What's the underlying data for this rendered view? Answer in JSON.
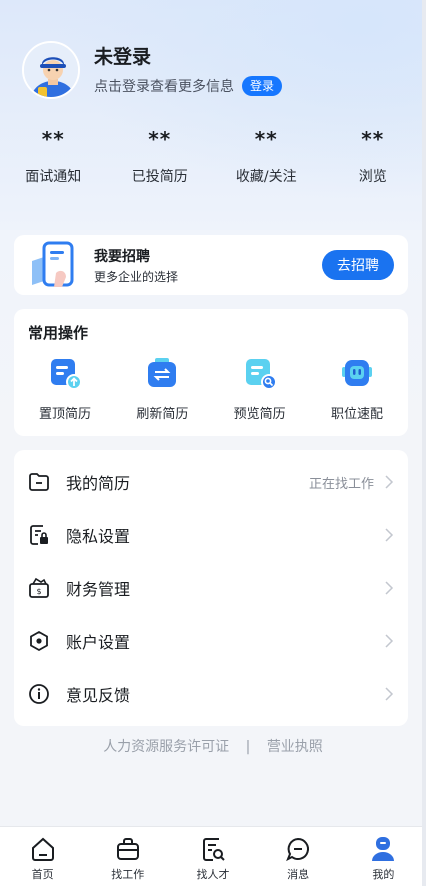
{
  "profile": {
    "name": "未登录",
    "hint": "点击登录查看更多信息",
    "login_label": "登录"
  },
  "stats": [
    {
      "value": "**",
      "label": "面试通知"
    },
    {
      "value": "**",
      "label": "已投简历"
    },
    {
      "value": "**",
      "label": "收藏/关注"
    },
    {
      "value": "**",
      "label": "浏览"
    }
  ],
  "recruit": {
    "title": "我要招聘",
    "subtitle": "更多企业的选择",
    "button_label": "去招聘"
  },
  "ops": {
    "title": "常用操作",
    "items": [
      {
        "label": "置顶简历",
        "icon": "pin-resume-icon"
      },
      {
        "label": "刷新简历",
        "icon": "refresh-resume-icon"
      },
      {
        "label": "预览简历",
        "icon": "preview-resume-icon"
      },
      {
        "label": "职位速配",
        "icon": "job-match-icon"
      }
    ]
  },
  "menu": {
    "items": [
      {
        "label": "我的简历",
        "status": "正在找工作",
        "icon": "folder-icon"
      },
      {
        "label": "隐私设置",
        "status": "",
        "icon": "privacy-lock-icon"
      },
      {
        "label": "财务管理",
        "status": "",
        "icon": "wallet-icon"
      },
      {
        "label": "账户设置",
        "status": "",
        "icon": "settings-hex-icon"
      },
      {
        "label": "意见反馈",
        "status": "",
        "icon": "info-icon"
      }
    ]
  },
  "footer": {
    "license": "人力资源服务许可证",
    "separator": "|",
    "business": "营业执照"
  },
  "tabbar": {
    "items": [
      {
        "label": "首页",
        "icon": "home-icon"
      },
      {
        "label": "找工作",
        "icon": "briefcase-icon"
      },
      {
        "label": "找人才",
        "icon": "search-talent-icon"
      },
      {
        "label": "消息",
        "icon": "message-icon"
      },
      {
        "label": "我的",
        "icon": "profile-icon"
      }
    ]
  },
  "colors": {
    "accent": "#1677ff",
    "text": "#1a1d21",
    "muted": "#8a8f99"
  }
}
